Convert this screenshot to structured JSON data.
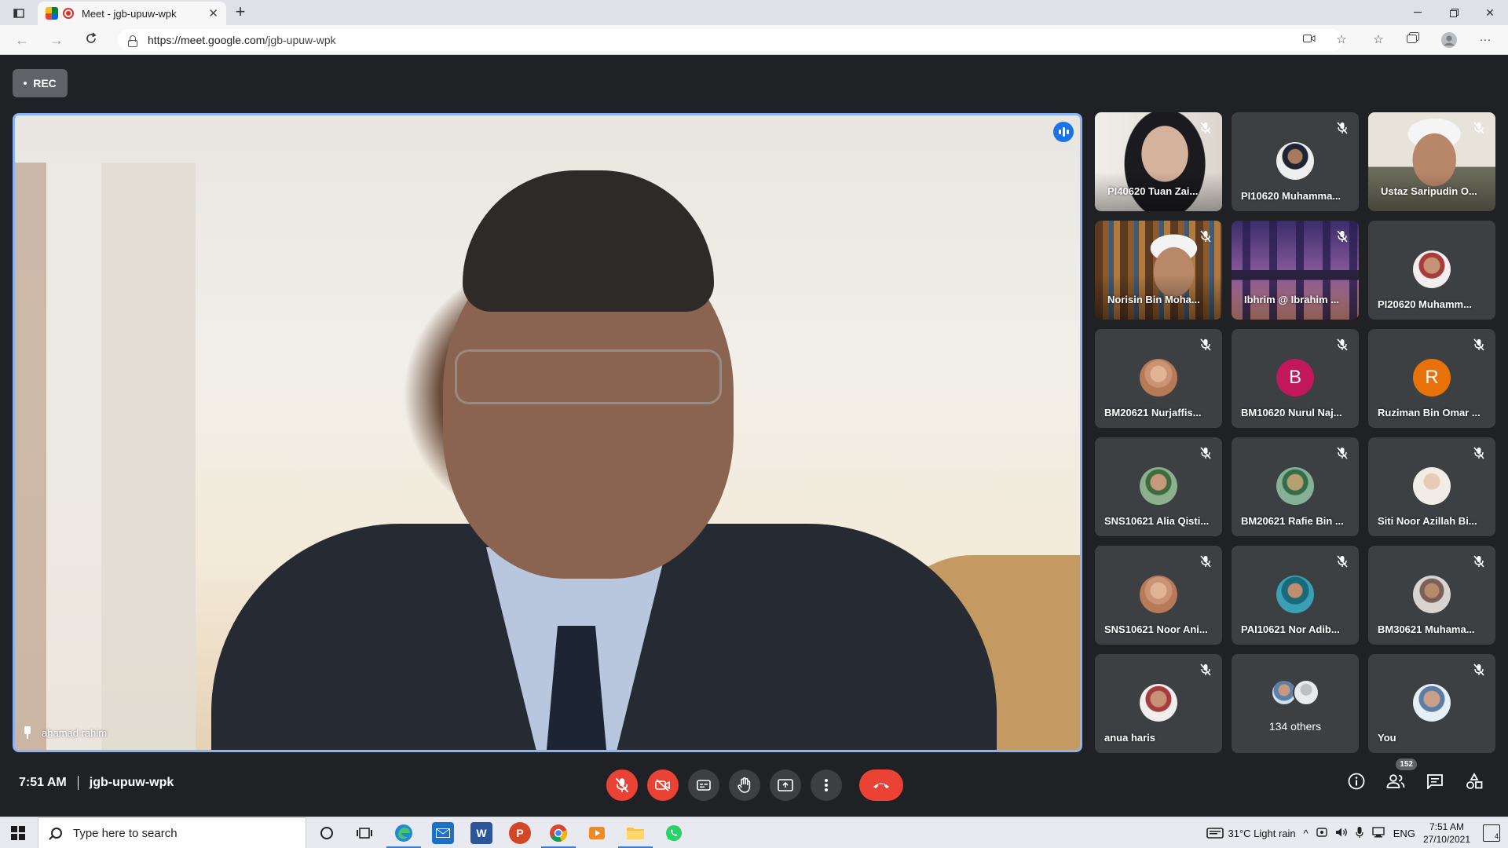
{
  "browser": {
    "tab_title": "Meet - jgb-upuw-wpk",
    "url_host": "https://meet.google.com",
    "url_path": "/jgb-upuw-wpk"
  },
  "meet": {
    "rec_label": "REC",
    "main_speaker_name": "ahamad rahim",
    "time": "7:51 AM",
    "meeting_code": "jgb-upuw-wpk",
    "participant_count": "152",
    "tiles": [
      {
        "name": "PI40620 Tuan Zai..."
      },
      {
        "name": "PI10620 Muhamma..."
      },
      {
        "name": "Ustaz Saripudin O..."
      },
      {
        "name": "Norisin Bin Moha..."
      },
      {
        "name": "Ibhrim @ Ibrahim ..."
      },
      {
        "name": "PI20620 Muhamm..."
      },
      {
        "name": "BM20621 Nurjaffis..."
      },
      {
        "name": "BM10620 Nurul Naj...",
        "initial": "B",
        "color": "#c2185b"
      },
      {
        "name": "Ruziman Bin Omar ...",
        "initial": "R",
        "color": "#e8710a"
      },
      {
        "name": "SNS10621 Alia Qisti..."
      },
      {
        "name": "BM20621 Rafie Bin ..."
      },
      {
        "name": "Siti Noor Azillah Bi..."
      },
      {
        "name": "SNS10621 Noor Ani..."
      },
      {
        "name": "PAI10621 Nor Adib..."
      },
      {
        "name": "BM30621 Muhama..."
      },
      {
        "name": "anua haris"
      },
      {
        "name": "134 others"
      },
      {
        "name": "You"
      }
    ]
  },
  "taskbar": {
    "search_placeholder": "Type here to search",
    "weather": "31°C  Light rain",
    "language": "ENG",
    "clock_time": "7:51 AM",
    "clock_date": "27/10/2021",
    "notification_count": "4"
  }
}
